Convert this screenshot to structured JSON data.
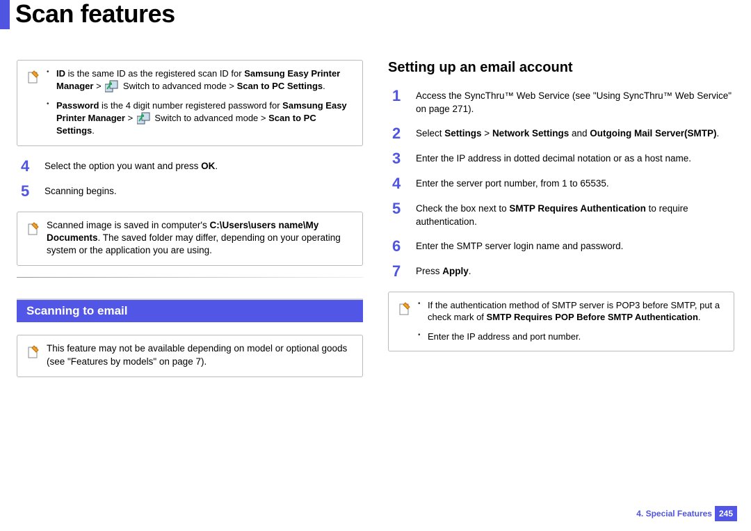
{
  "page_title": "Scan features",
  "left": {
    "note1": {
      "bullets": [
        {
          "parts": [
            {
              "t": "ID",
              "b": true
            },
            {
              "t": " is the same ID as the registered scan ID for "
            },
            {
              "t": "Samsung Easy Printer Manager",
              "b": true
            },
            {
              "t": " > ",
              "icon_after": true
            },
            {
              "t": " Switch to advanced mode > "
            },
            {
              "t": "Scan to PC Settings",
              "b": true
            },
            {
              "t": "."
            }
          ]
        },
        {
          "parts": [
            {
              "t": "Password",
              "b": true
            },
            {
              "t": " is the 4 digit number registered password for "
            },
            {
              "t": "Samsung Easy Printer Manager",
              "b": true
            },
            {
              "t": " > ",
              "icon_after": true
            },
            {
              "t": " Switch to advanced mode > "
            },
            {
              "t": "Scan to PC Settings",
              "b": true
            },
            {
              "t": "."
            }
          ]
        }
      ]
    },
    "steps": [
      {
        "n": "4",
        "parts": [
          {
            "t": "Select the option you want and press "
          },
          {
            "t": "OK",
            "b": true
          },
          {
            "t": "."
          }
        ]
      },
      {
        "n": "5",
        "parts": [
          {
            "t": "Scanning begins."
          }
        ]
      }
    ],
    "note2": {
      "plain": {
        "parts": [
          {
            "t": "Scanned image is saved in computer's "
          },
          {
            "t": "C:\\Users\\users name\\My Documents",
            "b": true
          },
          {
            "t": ". The saved folder may differ, depending on your operating system or the application you are using."
          }
        ]
      }
    },
    "section_title": "Scanning to email",
    "note3": {
      "plain": {
        "parts": [
          {
            "t": "This feature may not be available depending on model or optional goods (see \"Features by models\" on page 7)."
          }
        ]
      }
    }
  },
  "right": {
    "subhead": "Setting up an email account",
    "steps": [
      {
        "n": "1",
        "parts": [
          {
            "t": "Access the SyncThru™ Web Service (see \"Using SyncThru™ Web Service\" on page 271)."
          }
        ]
      },
      {
        "n": "2",
        "parts": [
          {
            "t": "Select "
          },
          {
            "t": "Settings",
            "b": true
          },
          {
            "t": " > "
          },
          {
            "t": "Network Settings",
            "b": true
          },
          {
            "t": " and "
          },
          {
            "t": "Outgoing Mail Server(SMTP)",
            "b": true
          },
          {
            "t": "."
          }
        ]
      },
      {
        "n": "3",
        "parts": [
          {
            "t": "Enter the IP address in dotted decimal notation or as a host name."
          }
        ]
      },
      {
        "n": "4",
        "parts": [
          {
            "t": "Enter the server port number, from 1 to 65535."
          }
        ]
      },
      {
        "n": "5",
        "parts": [
          {
            "t": "Check the box next to "
          },
          {
            "t": "SMTP Requires Authentication",
            "b": true
          },
          {
            "t": " to require authentication."
          }
        ]
      },
      {
        "n": "6",
        "parts": [
          {
            "t": "Enter the SMTP server login name and password."
          }
        ]
      },
      {
        "n": "7",
        "parts": [
          {
            "t": "Press "
          },
          {
            "t": "Apply",
            "b": true
          },
          {
            "t": "."
          }
        ]
      }
    ],
    "note": {
      "bullets": [
        {
          "parts": [
            {
              "t": "If the authentication method of SMTP server is POP3 before SMTP, put a check mark of "
            },
            {
              "t": "SMTP Requires POP Before SMTP Authentication",
              "b": true
            },
            {
              "t": "."
            }
          ]
        },
        {
          "parts": [
            {
              "t": "Enter the IP address and port number."
            }
          ]
        }
      ]
    }
  },
  "footer": {
    "chapter": "4.  Special Features",
    "page": "245"
  }
}
